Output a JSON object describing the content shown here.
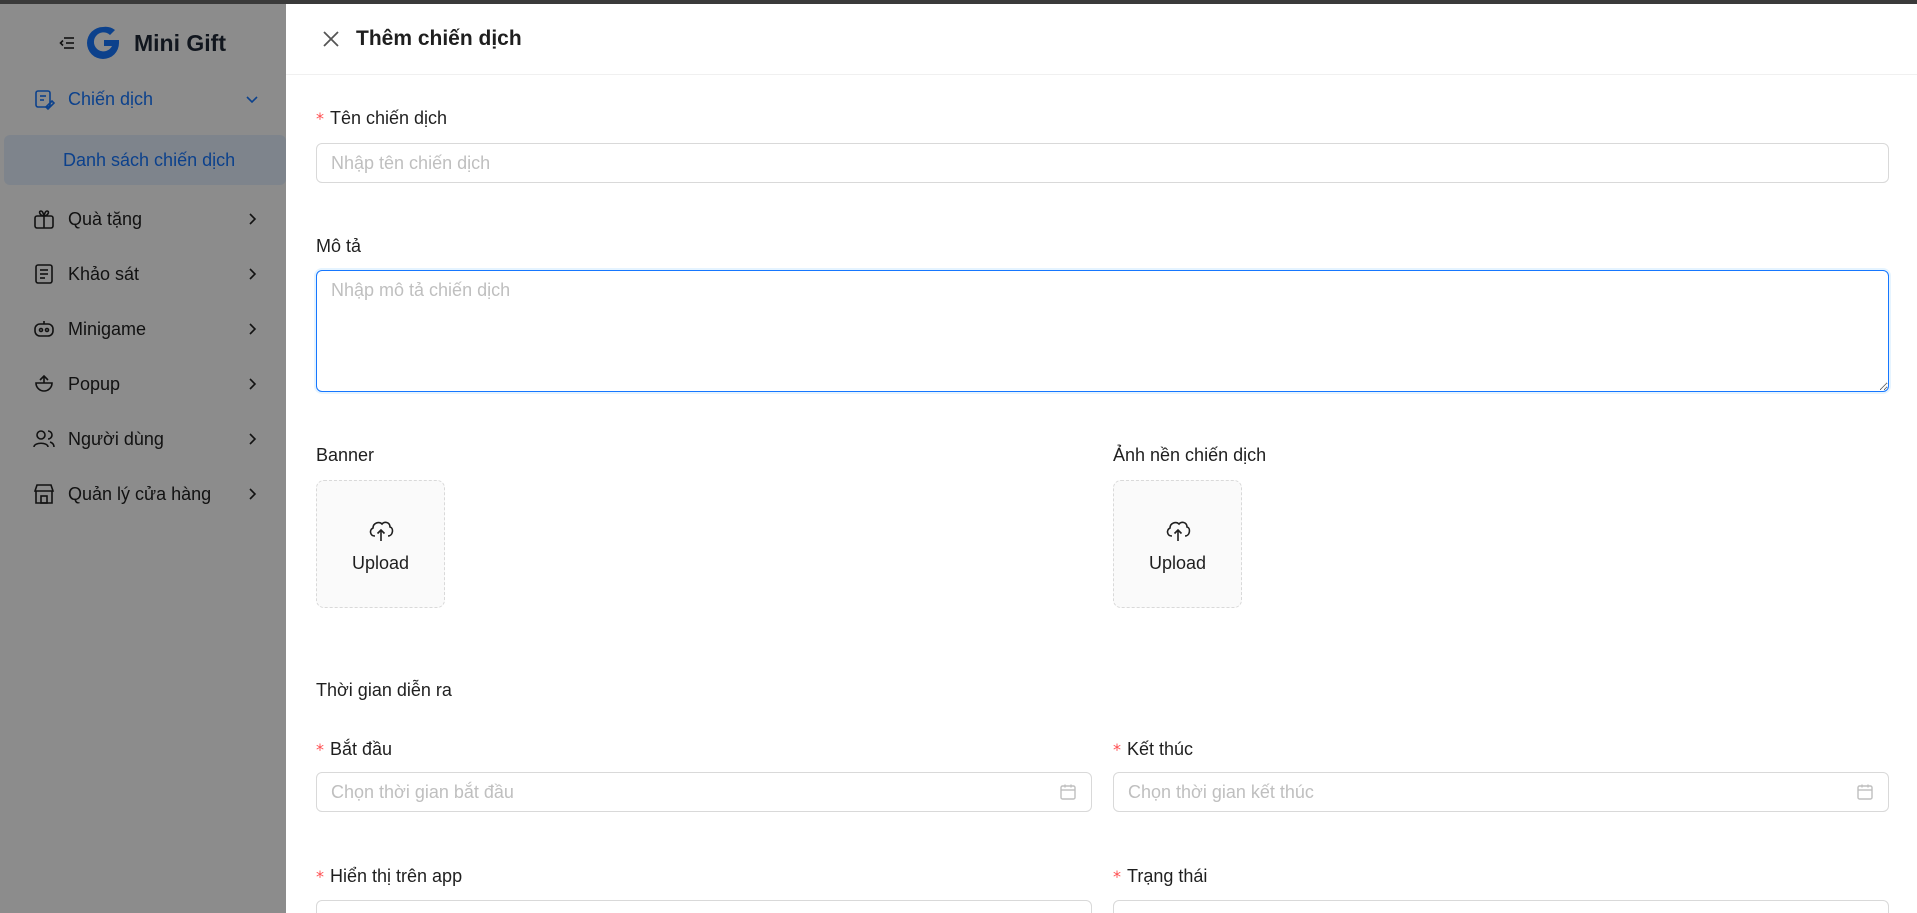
{
  "sidebar": {
    "brand": "Mini Gift",
    "items": [
      {
        "label": "Chiến dịch",
        "icon": "campaign-icon"
      },
      {
        "label": "Quà tặng",
        "icon": "gift-icon"
      },
      {
        "label": "Khảo sát",
        "icon": "survey-icon"
      },
      {
        "label": "Minigame",
        "icon": "game-icon"
      },
      {
        "label": "Popup",
        "icon": "popup-icon"
      },
      {
        "label": "Người dùng",
        "icon": "users-icon"
      },
      {
        "label": "Quản lý cửa hàng",
        "icon": "store-icon"
      }
    ],
    "sub_item": "Danh sách chiến dịch"
  },
  "drawer": {
    "title": "Thêm chiến dịch",
    "name_label": "Tên chiến dịch",
    "name_placeholder": "Nhập tên chiến dịch",
    "desc_label": "Mô tả",
    "desc_placeholder": "Nhập mô tả chiến dịch",
    "banner_label": "Banner",
    "background_label": "Ảnh nền chiến dịch",
    "upload_label": "Upload",
    "time_section": "Thời gian diễn ra",
    "start_label": "Bắt đầu",
    "start_placeholder": "Chọn thời gian bắt đầu",
    "end_label": "Kết thúc",
    "end_placeholder": "Chọn thời gian kết thúc",
    "display_label": "Hiển thị trên app",
    "status_label": "Trạng thái",
    "required_mark": "*"
  },
  "colors": {
    "accent": "#1677ff",
    "required": "#ff4d4f",
    "placeholder": "#bfbfbf"
  }
}
